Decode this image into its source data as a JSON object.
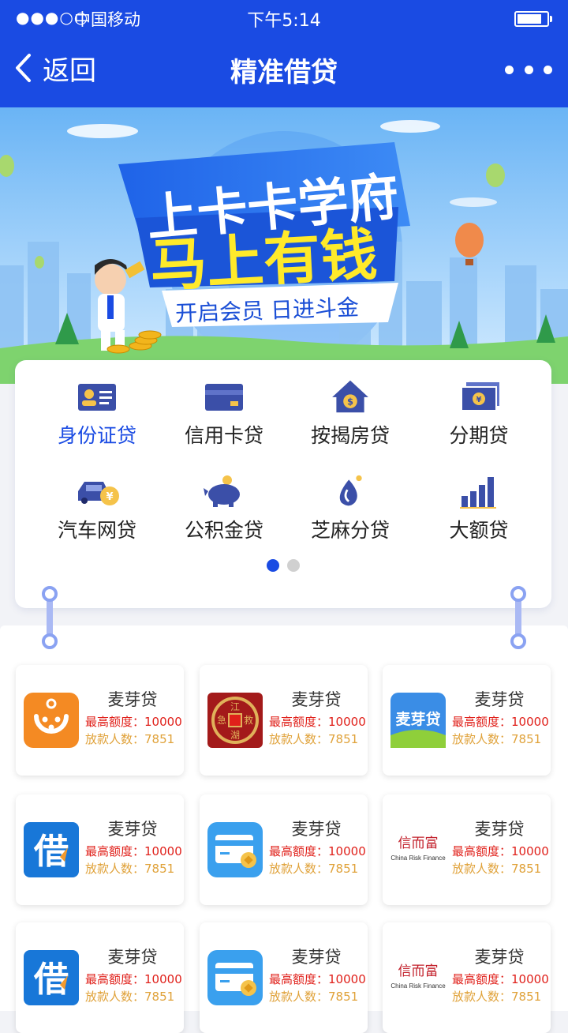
{
  "status_bar": {
    "signal": "●●●○○",
    "carrier": "中国移动",
    "time": "下午5:14"
  },
  "nav": {
    "back_label": "返回",
    "title": "精准借贷"
  },
  "banner": {
    "line1": "上卡卡学府",
    "line2": "马上有钱",
    "tagline": "开启会员 日进斗金"
  },
  "categories": [
    {
      "label": "身份证贷",
      "icon": "id-card-icon",
      "active": true
    },
    {
      "label": "信用卡贷",
      "icon": "credit-card-icon"
    },
    {
      "label": "按揭房贷",
      "icon": "house-icon"
    },
    {
      "label": "分期贷",
      "icon": "installment-icon"
    },
    {
      "label": "汽车网贷",
      "icon": "car-icon"
    },
    {
      "label": "公积金贷",
      "icon": "piggy-bank-icon"
    },
    {
      "label": "芝麻分贷",
      "icon": "sesame-icon"
    },
    {
      "label": "大额贷",
      "icon": "bar-chart-icon"
    }
  ],
  "pagination": {
    "pages": 2,
    "current": 1
  },
  "loan_label_limit": "最高额度：",
  "loan_label_count": "放款人数：",
  "loans": [
    {
      "name": "麦芽贷",
      "limit": "10000",
      "count": "7851",
      "logo": "orange-smile-logo"
    },
    {
      "name": "麦芽贷",
      "limit": "10000",
      "count": "7851",
      "logo": "jiang-coin-logo"
    },
    {
      "name": "麦芽贷",
      "limit": "10000",
      "count": "7851",
      "logo": "maiyadai-logo"
    },
    {
      "name": "麦芽贷",
      "limit": "10000",
      "count": "7851",
      "logo": "jie-logo"
    },
    {
      "name": "麦芽贷",
      "limit": "10000",
      "count": "7851",
      "logo": "card-coin-logo"
    },
    {
      "name": "麦芽贷",
      "limit": "10000",
      "count": "7851",
      "logo": "xinerfu-logo"
    },
    {
      "name": "麦芽贷",
      "limit": "10000",
      "count": "7851",
      "logo": "jie-logo"
    },
    {
      "name": "麦芽贷",
      "limit": "10000",
      "count": "7851",
      "logo": "card-coin-logo"
    },
    {
      "name": "麦芽贷",
      "limit": "10000",
      "count": "7851",
      "logo": "xinerfu-logo"
    }
  ],
  "logo_text": {
    "jiang_coin": [
      "江",
      "救",
      "湖",
      "急"
    ],
    "maiyadai": "麦芽贷",
    "jie": "借",
    "xinerfu_cn": "信而富",
    "xinerfu_en": "China Risk Finance"
  },
  "colors": {
    "brand": "#1a4be3",
    "limit": "#e0201a",
    "count": "#e0a23a"
  }
}
